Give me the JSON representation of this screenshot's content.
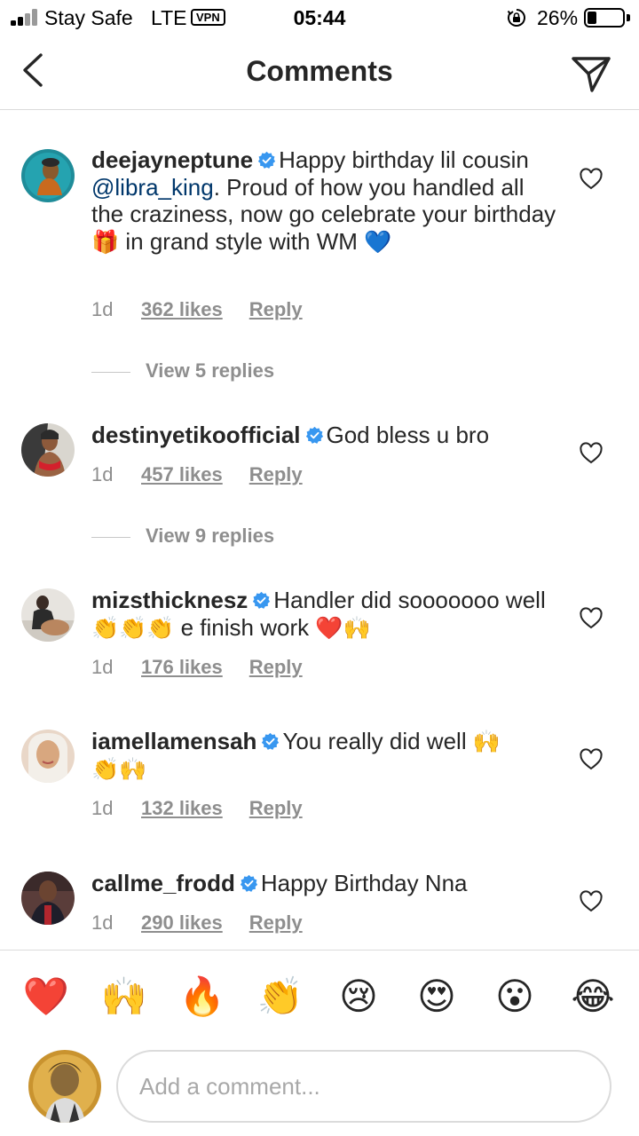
{
  "status_bar": {
    "carrier": "Stay Safe",
    "network": "LTE",
    "vpn_label": "VPN",
    "time": "05:44",
    "battery_percent": "26%",
    "battery_level": 0.26
  },
  "header": {
    "title": "Comments",
    "back_icon": "chevron-left-icon",
    "send_icon": "paper-plane-icon"
  },
  "colors": {
    "text": "#262626",
    "secondary_text": "#8e8e8e",
    "mention": "#00376b",
    "verified": "#3897f0",
    "divider": "#dbdbdb"
  },
  "comments": [
    {
      "username": "deejayneptune",
      "verified": true,
      "text_before_mention": "Happy birthday lil cousin ",
      "mention": "@libra_king",
      "text_after_mention": ".  Proud of how you handled all the craziness, now go celebrate your birthday ",
      "emoji_1": "🎁",
      "text_after_emoji": " in grand style with WM ",
      "emoji_2": "💙",
      "time": "1d",
      "likes": "362 likes",
      "reply": "Reply",
      "view_replies": "View 5 replies"
    },
    {
      "username": "destinyetikoofficial",
      "verified": true,
      "text": "God bless u bro",
      "time": "1d",
      "likes": "457 likes",
      "reply": "Reply",
      "view_replies": "View 9 replies"
    },
    {
      "username": "mizsthicknesz",
      "verified": true,
      "text": "Handler did sooooooo well ",
      "emoji_1": "👏👏👏",
      "text_after_emoji": " e finish work ",
      "emoji_2": "❤️🙌",
      "time": "1d",
      "likes": "176 likes",
      "reply": "Reply"
    },
    {
      "username": "iamellamensah",
      "verified": true,
      "text": "You really did well ",
      "emoji_1": "🙌",
      "emoji_2": "👏🙌",
      "time": "1d",
      "likes": "132 likes",
      "reply": "Reply"
    },
    {
      "username": "callme_frodd",
      "verified": true,
      "text": "Happy Birthday Nna",
      "time": "1d",
      "likes": "290 likes",
      "reply": "Reply"
    }
  ],
  "reactions": [
    "❤️",
    "🙌",
    "🔥",
    "👏",
    "😢",
    "😍",
    "😮",
    "😂"
  ],
  "composer": {
    "placeholder": "Add a comment..."
  }
}
